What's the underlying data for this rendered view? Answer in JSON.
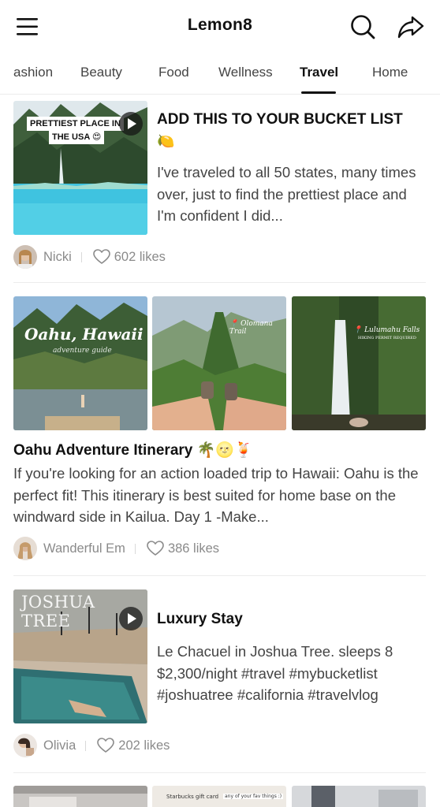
{
  "app": {
    "title": "Lemon8",
    "icons": {
      "menu": "hamburger-menu-icon",
      "search": "search-icon",
      "share": "share-arrow-icon"
    }
  },
  "tabs": [
    {
      "label": "ashion",
      "active": false
    },
    {
      "label": "Beauty",
      "active": false
    },
    {
      "label": "Food",
      "active": false
    },
    {
      "label": "Wellness",
      "active": false
    },
    {
      "label": "Travel",
      "active": true
    },
    {
      "label": "Home",
      "active": false
    }
  ],
  "posts": [
    {
      "title": "ADD THIS TO YOUR BUCKET LIST",
      "title_emoji": "🍋",
      "body": "I've traveled to all 50 states, many times over, just to find the prettiest place and I'm confident I did...",
      "thumb_caption_line1": "PRETTIEST PLACE IN",
      "thumb_caption_line2": "THE USA 😍",
      "has_video": true,
      "author": "Nicki",
      "likes": "602 likes"
    },
    {
      "title": "Oahu Adventure Itinerary 🌴🌝🍹",
      "body": "If you're looking for an action loaded trip to Hawaii: Oahu is the perfect fit! This itinerary is best suited for home base on the windward side in Kailua. Day 1 -Make...",
      "images": [
        {
          "caption": "Oahu, Hawaii",
          "subcaption": "adventure guide"
        },
        {
          "caption": "📍 Olomana Trail"
        },
        {
          "caption": "📍 Lulumahu Falls",
          "subcaption": "HIKING PERMIT REQUIRED"
        }
      ],
      "author": "Wanderful Em",
      "likes": "386 likes"
    },
    {
      "title": "Luxury Stay",
      "body": "Le Chacuel in Joshua Tree. sleeps 8 $2,300/night #travel #mybucketlist #joshuatree #california #travelvlog",
      "thumb_caption": "JOSHUA TREE",
      "has_video": true,
      "author": "Olivia",
      "likes": "202 likes"
    },
    {
      "images": [
        {
          "caption": ""
        },
        {
          "caption": "Starbucks gift card",
          "subcaption": "any of your fav things :)"
        },
        {
          "caption": ""
        }
      ]
    }
  ]
}
